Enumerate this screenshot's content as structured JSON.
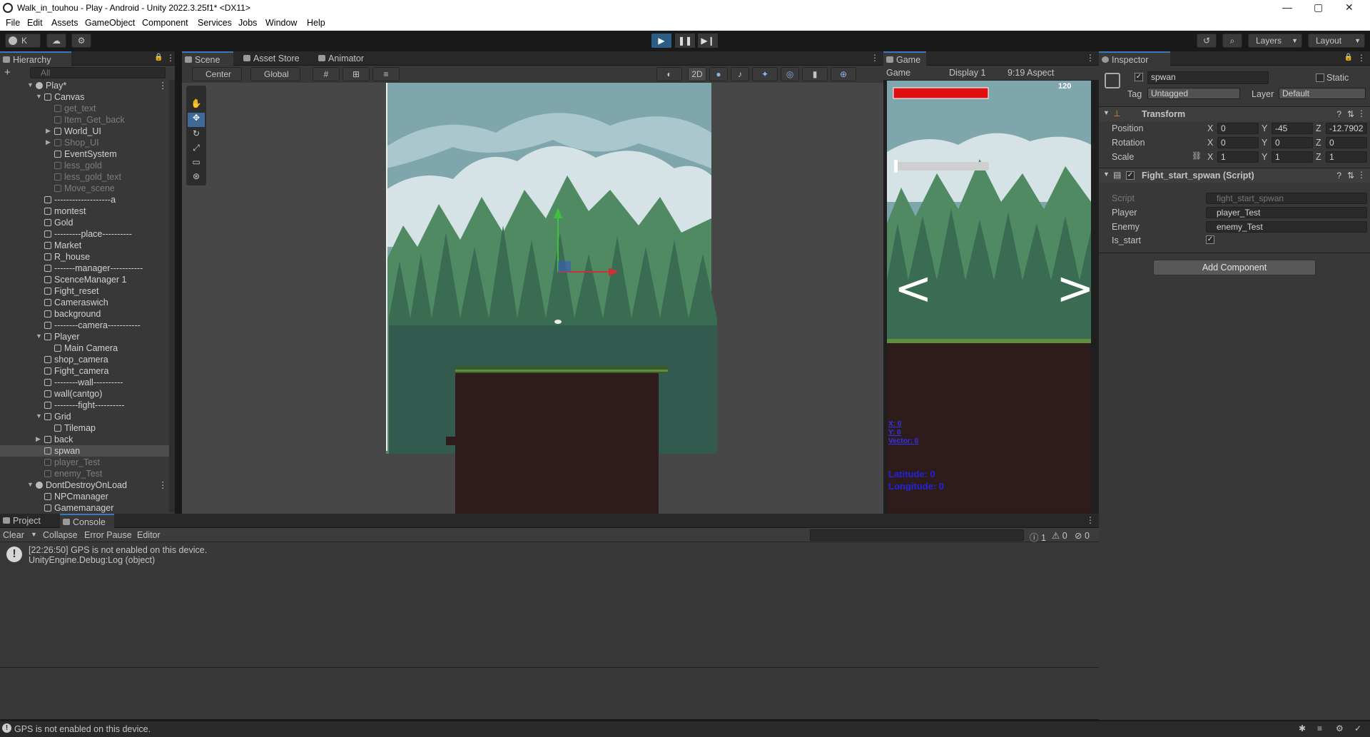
{
  "window": {
    "title": "Walk_in_touhou - Play - Android - Unity 2022.3.25f1* <DX11>",
    "minimize": "—",
    "maximize": "▢",
    "close": "✕"
  },
  "menu": [
    "File",
    "Edit",
    "Assets",
    "GameObject",
    "Component",
    "Services",
    "Jobs",
    "Window",
    "Help"
  ],
  "toolbar": {
    "account": "K",
    "layers_label": "Layers",
    "layout_label": "Layout"
  },
  "hierarchy": {
    "tab": "Hierarchy",
    "search_placeholder": "All",
    "root": "Play*",
    "items": [
      {
        "label": "Canvas",
        "indent": 1,
        "expanded": true,
        "dim": false
      },
      {
        "label": "get_text",
        "indent": 2,
        "dim": true
      },
      {
        "label": "Item_Get_back",
        "indent": 2,
        "dim": true
      },
      {
        "label": "World_UI",
        "indent": 2,
        "collapsed": true,
        "dim": false
      },
      {
        "label": "Shop_UI",
        "indent": 2,
        "collapsed": true,
        "dim": true
      },
      {
        "label": "EventSystem",
        "indent": 2,
        "dim": false
      },
      {
        "label": "less_gold",
        "indent": 2,
        "dim": true
      },
      {
        "label": "less_gold_text",
        "indent": 2,
        "dim": true
      },
      {
        "label": "Move_scene",
        "indent": 2,
        "dim": true
      },
      {
        "label": "-------------------a",
        "indent": 1,
        "dim": false
      },
      {
        "label": "montest",
        "indent": 1,
        "dim": false
      },
      {
        "label": "Gold",
        "indent": 1,
        "dim": false
      },
      {
        "label": "---------place----------",
        "indent": 1,
        "dim": false
      },
      {
        "label": "Market",
        "indent": 1,
        "dim": false
      },
      {
        "label": "R_house",
        "indent": 1,
        "dim": false
      },
      {
        "label": "-------manager-----------",
        "indent": 1,
        "dim": false
      },
      {
        "label": "ScenceManager 1",
        "indent": 1,
        "dim": false
      },
      {
        "label": "Fight_reset",
        "indent": 1,
        "dim": false
      },
      {
        "label": "Cameraswich",
        "indent": 1,
        "dim": false
      },
      {
        "label": "background",
        "indent": 1,
        "dim": false
      },
      {
        "label": "--------camera-----------",
        "indent": 1,
        "dim": false
      },
      {
        "label": "Player",
        "indent": 1,
        "expanded": true,
        "dim": false
      },
      {
        "label": "Main Camera",
        "indent": 2,
        "dim": false
      },
      {
        "label": "shop_camera",
        "indent": 1,
        "dim": false
      },
      {
        "label": "Fight_camera",
        "indent": 1,
        "dim": false
      },
      {
        "label": "--------wall----------",
        "indent": 1,
        "dim": false
      },
      {
        "label": "wall(cantgo)",
        "indent": 1,
        "dim": false
      },
      {
        "label": "--------fight----------",
        "indent": 1,
        "dim": false
      },
      {
        "label": "Grid",
        "indent": 1,
        "expanded": true,
        "dim": false
      },
      {
        "label": "Tilemap",
        "indent": 2,
        "dim": false
      },
      {
        "label": "back",
        "indent": 1,
        "collapsed": true,
        "dim": false
      },
      {
        "label": "spwan",
        "indent": 1,
        "dim": false,
        "selected": true
      },
      {
        "label": "player_Test",
        "indent": 1,
        "dim": true
      },
      {
        "label": "enemy_Test",
        "indent": 1,
        "dim": true
      }
    ],
    "dont_destroy": "DontDestroyOnLoad",
    "dd_items": [
      "NPCmanager",
      "Gamemanager"
    ]
  },
  "scene": {
    "tabs": [
      "Scene",
      "Asset Store",
      "Animator"
    ],
    "pivot": "Center",
    "space": "Global",
    "mode_2d": "2D"
  },
  "game": {
    "tab": "Game",
    "mode": "Game",
    "display": "Display 1",
    "aspect": "9:19 Aspect",
    "hp_value": "120",
    "coords": [
      "X: 0",
      "Y: 0",
      "Vector: 0"
    ],
    "gps": [
      "Latitude: 0",
      "Longitude: 0"
    ],
    "arrow_left": "<",
    "arrow_right": ">"
  },
  "inspector": {
    "tab": "Inspector",
    "object_name": "spwan",
    "static_label": "Static",
    "tag_label": "Tag",
    "tag_value": "Untagged",
    "layer_label": "Layer",
    "layer_value": "Default",
    "transform": {
      "title": "Transform",
      "position_label": "Position",
      "position": [
        "0",
        "-45",
        "-12.7902"
      ],
      "rotation_label": "Rotation",
      "rotation": [
        "0",
        "0",
        "0"
      ],
      "scale_label": "Scale",
      "scale": [
        "1",
        "1",
        "1"
      ]
    },
    "script_component": {
      "title": "Fight_start_spwan (Script)",
      "script_label": "Script",
      "script_value": "fight_start_spwan",
      "player_label": "Player",
      "player_value": "player_Test",
      "enemy_label": "Enemy",
      "enemy_value": "enemy_Test",
      "is_start_label": "Is_start",
      "is_start": true
    },
    "add_component": "Add Component"
  },
  "console": {
    "tabs": [
      "Project",
      "Console"
    ],
    "clear": "Clear",
    "collapse": "Collapse",
    "error_pause": "Error Pause",
    "editor": "Editor",
    "counts": {
      "info": "1",
      "warn": "0",
      "error": "0"
    },
    "entry_line1": "[22:26:50] GPS is not enabled on this device.",
    "entry_line2": "UnityEngine.Debug:Log (object)"
  },
  "status": {
    "message": "GPS is not enabled on this device."
  },
  "colors": {
    "accent": "#3a79bb",
    "hp_bar": "#e01010",
    "gps_text": "#2222dd"
  }
}
